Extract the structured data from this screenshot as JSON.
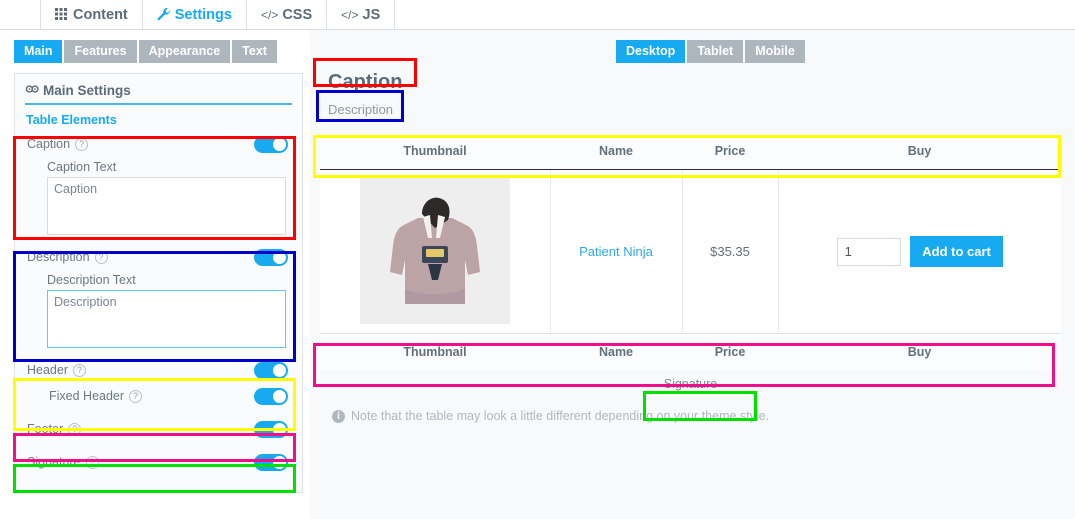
{
  "top_nav": {
    "tabs": [
      {
        "label": "Content",
        "icon": "grid-icon",
        "active": false
      },
      {
        "label": "Settings",
        "icon": "wrench-icon",
        "active": true
      },
      {
        "label": "CSS",
        "icon": "code-icon",
        "active": false
      },
      {
        "label": "JS",
        "icon": "code-icon",
        "active": false
      }
    ]
  },
  "sub_tabs": [
    {
      "label": "Main",
      "active": true
    },
    {
      "label": "Features",
      "active": false
    },
    {
      "label": "Appearance",
      "active": false
    },
    {
      "label": "Text",
      "active": false
    }
  ],
  "settings_panel": {
    "title": "Main Settings",
    "title_icon": "gear-icon",
    "section_label": "Table Elements",
    "rows": [
      {
        "label": "Caption",
        "help": "?",
        "toggle": "on"
      },
      {
        "label": "Description",
        "help": "?",
        "toggle": "on"
      },
      {
        "label": "Header",
        "help": "?",
        "toggle": "on"
      },
      {
        "label": "Fixed Header",
        "help": "?",
        "toggle": "on"
      },
      {
        "label": "Footer",
        "help": "?",
        "toggle": "on"
      },
      {
        "label": "Signature",
        "help": "?",
        "toggle": "on"
      }
    ],
    "caption_field": {
      "label": "Caption Text",
      "value": "Caption"
    },
    "description_field": {
      "label": "Description Text",
      "value": "Description",
      "focused": true
    }
  },
  "device_tabs": [
    {
      "label": "Desktop",
      "active": true
    },
    {
      "label": "Tablet",
      "active": false
    },
    {
      "label": "Mobile",
      "active": false
    }
  ],
  "preview": {
    "caption": "Caption",
    "description": "Description",
    "columns": [
      "Thumbnail",
      "Name",
      "Price",
      "Buy"
    ],
    "rows": [
      {
        "thumbnail": "hoodie-product-image",
        "name": "Patient Ninja",
        "price": "$35.35",
        "quantity": "1",
        "buy_label": "Add to cart"
      }
    ],
    "signature": "Signature",
    "note": "Note that the table may look a little different depending on your theme style.",
    "note_icon": "info-icon"
  },
  "annotations": [
    {
      "name": "caption-setting-highlight",
      "color": "#ff0000"
    },
    {
      "name": "description-setting-highlight",
      "color": "#0000cc"
    },
    {
      "name": "header-setting-highlight",
      "color": "#ffff00"
    },
    {
      "name": "footer-setting-highlight",
      "color": "#ef0f8a"
    },
    {
      "name": "signature-setting-highlight",
      "color": "#00e000"
    },
    {
      "name": "caption-preview-highlight",
      "color": "#ff0000"
    },
    {
      "name": "description-preview-highlight",
      "color": "#0000cc"
    },
    {
      "name": "header-preview-highlight",
      "color": "#ffff00"
    },
    {
      "name": "footer-preview-highlight",
      "color": "#ef0f8a"
    },
    {
      "name": "signature-preview-highlight",
      "color": "#00e000"
    }
  ],
  "colors": {
    "accent_blue": "#17aaf0",
    "tab_gray": "#adb5bd",
    "text_gray": "#62707c"
  }
}
